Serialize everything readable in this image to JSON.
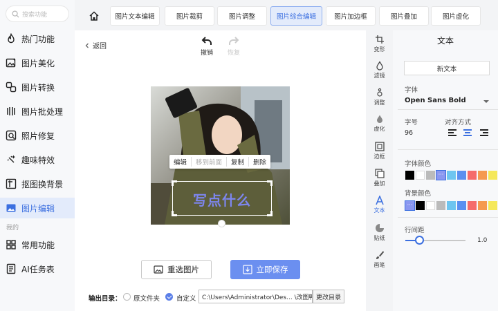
{
  "search": {
    "placeholder": "搜索功能"
  },
  "sidebar": {
    "items": [
      {
        "label": "热门功能",
        "icon": "flame-icon"
      },
      {
        "label": "图片美化",
        "icon": "image-enhance-icon"
      },
      {
        "label": "图片转换",
        "icon": "convert-icon"
      },
      {
        "label": "图片批处理",
        "icon": "batch-icon"
      },
      {
        "label": "照片修复",
        "icon": "repair-icon"
      },
      {
        "label": "趣味特效",
        "icon": "sparkle-icon"
      },
      {
        "label": "抠图换背景",
        "icon": "cutout-icon"
      },
      {
        "label": "图片编辑",
        "icon": "image-edit-icon",
        "active": true
      }
    ],
    "section_label": "我的",
    "my_items": [
      {
        "label": "常用功能",
        "icon": "grid-icon"
      },
      {
        "label": "AI任务表",
        "icon": "list-icon"
      }
    ]
  },
  "tabs": [
    "图片文本编辑",
    "图片裁剪",
    "图片调整",
    "图片综合编辑",
    "图片加边框",
    "图片叠加",
    "图片虚化"
  ],
  "active_tab": "图片综合编辑",
  "editor": {
    "back": "返回",
    "undo": "撤销",
    "redo": "恢复",
    "context_menu": [
      "编辑",
      "移到前面",
      "复制",
      "删除"
    ],
    "text_box_content": "写点什么",
    "reselect": "重选图片",
    "save": "立即保存",
    "output_label": "输出目录：",
    "option_original": "原文件夹",
    "option_custom": "自定义",
    "path": "C:\\Users\\Administrator\\Des... \\改图鸭",
    "change_dir": "更改目录"
  },
  "tools": [
    {
      "label": "变形",
      "icon": "transform-icon"
    },
    {
      "label": "滤镜",
      "icon": "filter-icon"
    },
    {
      "label": "调整",
      "icon": "adjust-icon"
    },
    {
      "label": "虚化",
      "icon": "blur-icon"
    },
    {
      "label": "边框",
      "icon": "frame-icon"
    },
    {
      "label": "叠加",
      "icon": "overlay-icon"
    },
    {
      "label": "文本",
      "icon": "text-icon",
      "active": true
    },
    {
      "label": "贴纸",
      "icon": "sticker-icon"
    },
    {
      "label": "画笔",
      "icon": "brush-icon"
    }
  ],
  "panel": {
    "title": "文本",
    "new_text": "新文本",
    "font_label": "字体",
    "font_value": "Open Sans Bold",
    "size_label": "字号",
    "size_value": "96",
    "align_label": "对齐方式",
    "align_selected": "center",
    "font_color_label": "字体颜色",
    "font_colors": [
      "#000000",
      "#ffffff",
      "#bbbbbb",
      "#8a97f0",
      "#6ec5f0",
      "#5a8ff0",
      "#f56b6b",
      "#f59a50",
      "#f5e85a"
    ],
    "bg_color_label": "背景颜色",
    "bg_colors": [
      "none",
      "#000000",
      "#ffffff",
      "#bbbbbb",
      "#6ec5f0",
      "#5a8ff0",
      "#f56b6b",
      "#f59a50",
      "#f5e85a"
    ],
    "line_height_label": "行间距",
    "line_height_value": "1.0"
  }
}
